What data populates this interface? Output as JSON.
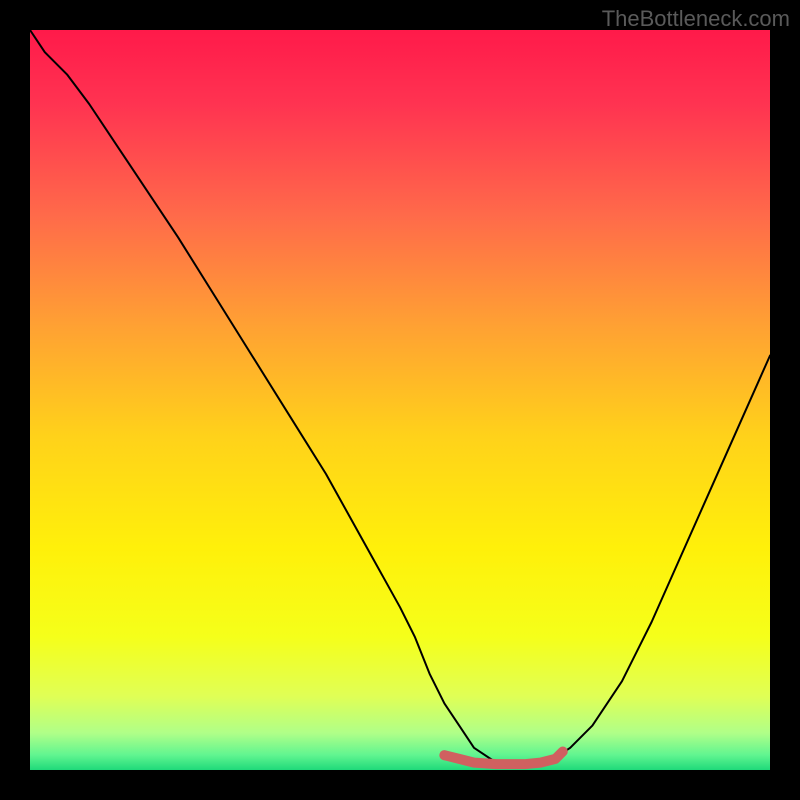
{
  "watermark": "TheBottleneck.com",
  "chart_data": {
    "type": "line",
    "title": "",
    "xlabel": "",
    "ylabel": "",
    "xlim": [
      0,
      100
    ],
    "ylim": [
      0,
      100
    ],
    "grid": false,
    "legend": false,
    "legend_position": "none",
    "background_gradient": {
      "stops": [
        {
          "pos": 0.0,
          "color": "#ff1a4a"
        },
        {
          "pos": 0.1,
          "color": "#ff3351"
        },
        {
          "pos": 0.25,
          "color": "#ff6a4a"
        },
        {
          "pos": 0.4,
          "color": "#ffa133"
        },
        {
          "pos": 0.55,
          "color": "#ffd21a"
        },
        {
          "pos": 0.7,
          "color": "#fff00a"
        },
        {
          "pos": 0.82,
          "color": "#f5ff1a"
        },
        {
          "pos": 0.9,
          "color": "#e0ff55"
        },
        {
          "pos": 0.95,
          "color": "#b0ff88"
        },
        {
          "pos": 0.98,
          "color": "#60f590"
        },
        {
          "pos": 1.0,
          "color": "#1fd97a"
        }
      ]
    },
    "series": [
      {
        "name": "bottleneck-curve",
        "color": "#000000",
        "width": 2,
        "x": [
          0,
          2,
          5,
          8,
          12,
          16,
          20,
          25,
          30,
          35,
          40,
          45,
          50,
          52,
          54,
          56,
          58,
          60,
          63,
          65,
          67,
          70,
          73,
          76,
          80,
          84,
          88,
          92,
          96,
          100
        ],
        "y": [
          100,
          97,
          94,
          90,
          84,
          78,
          72,
          64,
          56,
          48,
          40,
          31,
          22,
          18,
          13,
          9,
          6,
          3,
          1,
          0.5,
          0.5,
          1,
          3,
          6,
          12,
          20,
          29,
          38,
          47,
          56
        ]
      },
      {
        "name": "optimal-range-marker",
        "color": "#d06060",
        "width": 10,
        "cap": "round",
        "x": [
          56,
          58,
          60,
          63,
          65,
          67,
          69,
          71,
          72
        ],
        "y": [
          2.0,
          1.5,
          1.0,
          0.8,
          0.8,
          0.8,
          1.0,
          1.5,
          2.5
        ]
      }
    ],
    "markers": [
      {
        "name": "optimal-point",
        "x": 56,
        "y": 2.0,
        "r": 5,
        "color": "#d06060"
      }
    ]
  }
}
